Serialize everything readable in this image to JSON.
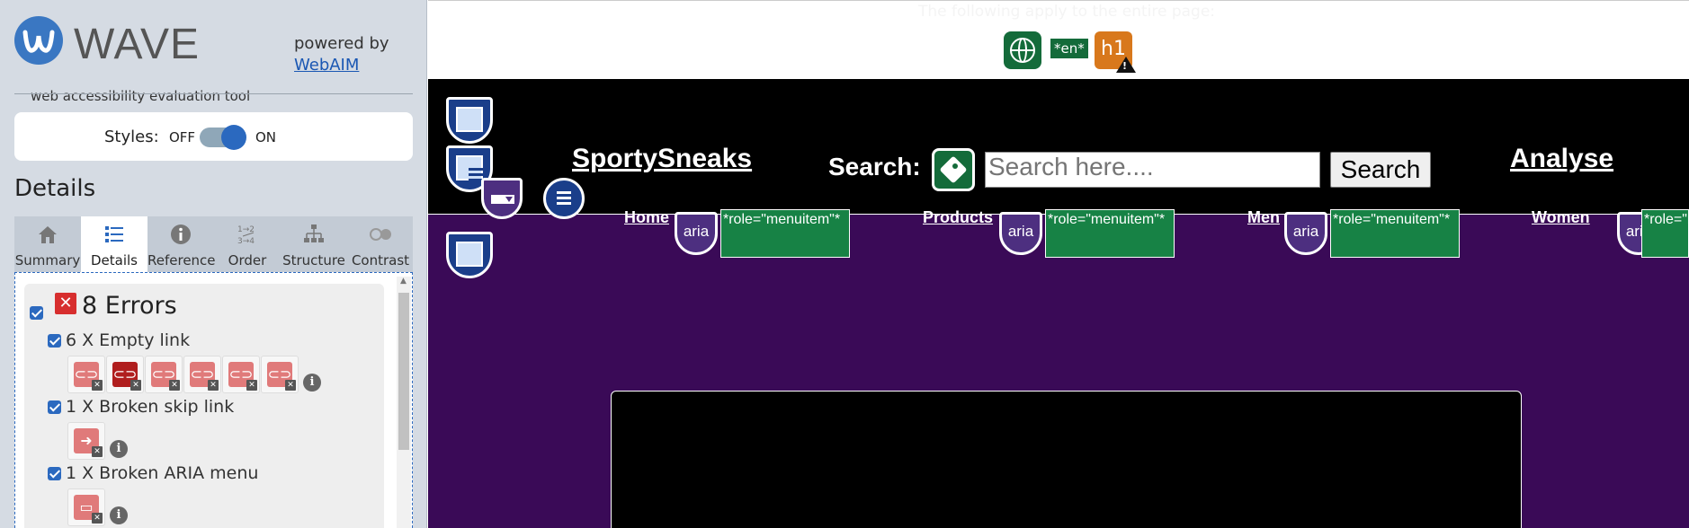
{
  "sidebar": {
    "logo_word": "WAVE",
    "tagline": "web accessibility evaluation tool",
    "powered_by": "powered by",
    "powered_link": "WebAIM",
    "styles": {
      "label": "Styles:",
      "off": "OFF",
      "on": "ON",
      "state": "on"
    },
    "details_heading": "Details",
    "tabs": [
      {
        "label": "Summary",
        "icon": "home-icon"
      },
      {
        "label": "Details",
        "icon": "list-icon",
        "active": true
      },
      {
        "label": "Reference",
        "icon": "info-icon"
      },
      {
        "label": "Order",
        "icon": "order-icon"
      },
      {
        "label": "Structure",
        "icon": "structure-icon"
      },
      {
        "label": "Contrast",
        "icon": "contrast-icon"
      }
    ],
    "errors": {
      "title": "8 Errors",
      "items": [
        {
          "label": "6 X Empty link",
          "icon_count": 6
        },
        {
          "label": "1 X Broken skip link",
          "icon_count": 1
        },
        {
          "label": "1 X Broken ARIA menu",
          "icon_count": 1
        }
      ]
    }
  },
  "main": {
    "top_note": "The following apply to the entire page:",
    "lang_badge": "*en*",
    "h1_badge": "h1",
    "brand": "SportySneaks",
    "search_label": "Search:",
    "search_placeholder": "Search here....",
    "search_button": "Search",
    "analyse": "Analyse",
    "nav": [
      {
        "label": "Home",
        "aria": "aria",
        "role": "*role=\"menuitem\"*"
      },
      {
        "label": "Products",
        "aria": "aria",
        "role": "*role=\"menuitem\"*"
      },
      {
        "label": "Men",
        "aria": "aria",
        "role": "*role=\"menuitem\"*"
      },
      {
        "label": "Women",
        "aria": "aria",
        "role": "*role=\"menuitem\"*"
      }
    ]
  },
  "colors": {
    "wave_blue": "#2b69bf",
    "sidebar_bg": "#d5dbe3",
    "error_red": "#d72e2e",
    "site_purple": "#3a0a57",
    "aria_green": "#178245"
  }
}
